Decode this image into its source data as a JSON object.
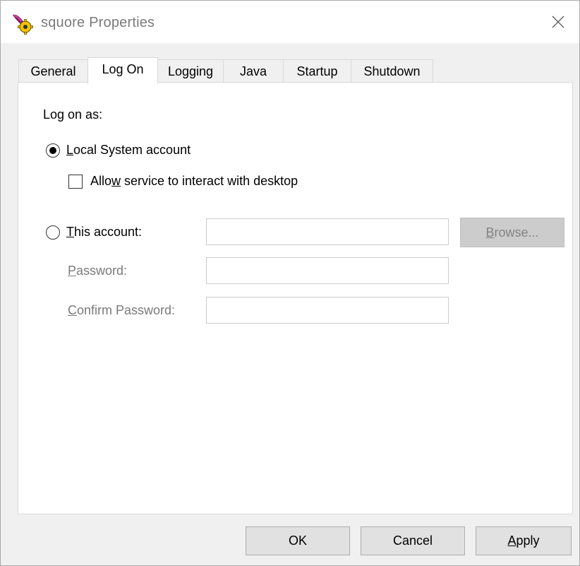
{
  "window": {
    "title": "squore Properties",
    "close_symbol": "✕"
  },
  "tabs": [
    {
      "label": "General",
      "active": false
    },
    {
      "label": "Log On",
      "active": true
    },
    {
      "label": "Logging",
      "active": false
    },
    {
      "label": "Java",
      "active": false
    },
    {
      "label": "Startup",
      "active": false
    },
    {
      "label": "Shutdown",
      "active": false
    }
  ],
  "logon": {
    "heading": "Log on as:",
    "local_system": {
      "mnemonic": "L",
      "rest": "ocal System account",
      "selected": true
    },
    "interact_desktop": {
      "pre": "Allo",
      "mnemonic": "w",
      "post": " service to interact with desktop",
      "checked": false
    },
    "this_account": {
      "mnemonic": "T",
      "rest": "his account:",
      "selected": false,
      "value": ""
    },
    "password": {
      "mnemonic": "P",
      "rest": "assword:",
      "value": ""
    },
    "confirm_password": {
      "mnemonic": "C",
      "rest": "onfirm Password:",
      "value": ""
    },
    "browse": {
      "mnemonic": "B",
      "rest": "rowse...",
      "enabled": false
    }
  },
  "footer": {
    "ok": "OK",
    "cancel": "Cancel",
    "apply_mnemonic": "A",
    "apply_rest": "pply"
  },
  "colors": {
    "window_bg": "#f0f0f0",
    "panel_bg": "#ffffff",
    "disabled_text": "#7a7a7a",
    "button_bg": "#e1e1e1"
  }
}
